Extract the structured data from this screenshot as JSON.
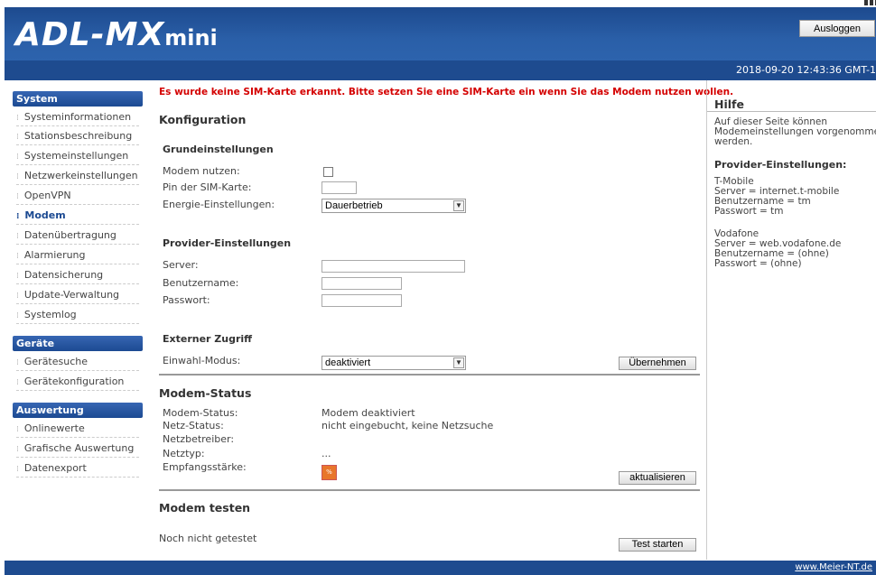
{
  "header": {
    "logo_main": "ADL-MX",
    "logo_suffix": "mini",
    "logout_label": "Ausloggen",
    "datetime": "2018-09-20 12:43:36 GMT-1"
  },
  "sidebar": {
    "sections": [
      {
        "title": "System",
        "items": [
          "Systeminformationen",
          "Stationsbeschreibung",
          "Systemeinstellungen",
          "Netzwerkeinstellungen",
          "OpenVPN",
          "Modem",
          "Datenübertragung",
          "Alarmierung",
          "Datensicherung",
          "Update-Verwaltung",
          "Systemlog"
        ]
      },
      {
        "title": "Geräte",
        "items": [
          "Gerätesuche",
          "Gerätekonfiguration"
        ]
      },
      {
        "title": "Auswertung",
        "items": [
          "Onlinewerte",
          "Grafische Auswertung",
          "Datenexport"
        ]
      }
    ],
    "active_item": "Modem"
  },
  "main": {
    "warning": "Es wurde keine SIM-Karte erkannt. Bitte setzen Sie eine SIM-Karte ein wenn Sie das Modem nutzen wollen.",
    "config_title": "Konfiguration",
    "basic": {
      "title": "Grundeinstellungen",
      "use_modem_label": "Modem nutzen:",
      "use_modem_checked": false,
      "sim_pin_label": "Pin der SIM-Karte:",
      "sim_pin_value": "",
      "energy_label": "Energie-Einstellungen:",
      "energy_value": "Dauerbetrieb"
    },
    "provider": {
      "title": "Provider-Einstellungen",
      "server_label": "Server:",
      "server_value": "",
      "username_label": "Benutzername:",
      "username_value": "",
      "password_label": "Passwort:",
      "password_value": ""
    },
    "external": {
      "title": "Externer Zugriff",
      "dialin_label": "Einwahl-Modus:",
      "dialin_value": "deaktiviert",
      "apply_label": "Übernehmen"
    },
    "status": {
      "title": "Modem-Status",
      "modem_status_label": "Modem-Status:",
      "modem_status_value": "Modem deaktiviert",
      "net_status_label": "Netz-Status:",
      "net_status_value": "nicht eingebucht, keine Netzsuche",
      "operator_label": "Netzbetreiber:",
      "operator_value": "",
      "nettype_label": "Netztyp:",
      "nettype_value": "...",
      "signal_label": "Empfangsstärke:",
      "signal_value": "%",
      "refresh_label": "aktualisieren"
    },
    "test": {
      "title": "Modem testen",
      "result": "Noch nicht getestet",
      "start_label": "Test starten"
    }
  },
  "help": {
    "title": "Hilfe",
    "intro": "Auf dieser Seite können\nModemeinstellungen vorgenommen\nwerden.",
    "provider_title": "Provider-Einstellungen:",
    "tmobile": "T-Mobile\nServer = internet.t-mobile\nBenutzername = tm\nPasswort = tm",
    "vodafone": "Vodafone\nServer = web.vodafone.de\nBenutzername = (ohne)\nPasswort = (ohne)"
  },
  "footer": {
    "link": "www.Meier-NT.de"
  },
  "colors": {
    "header_blue": "#1e4b8f",
    "warning_red": "#d40000",
    "signal_orange": "#e8762b"
  }
}
